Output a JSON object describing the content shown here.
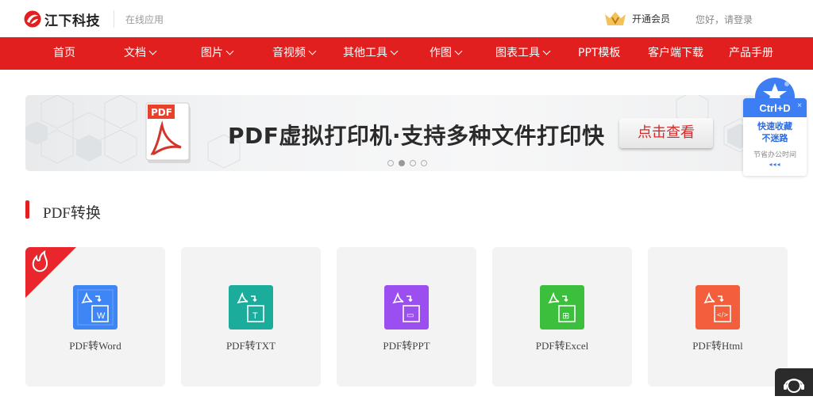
{
  "header": {
    "logo_text": "江下科技",
    "subtitle": "在线应用",
    "vip_label": "开通会员",
    "login_label": "您好，请登录"
  },
  "nav": {
    "items": [
      {
        "label": "首页",
        "has_dropdown": false
      },
      {
        "label": "文档",
        "has_dropdown": true
      },
      {
        "label": "图片",
        "has_dropdown": true
      },
      {
        "label": "音视频",
        "has_dropdown": true
      },
      {
        "label": "其他工具",
        "has_dropdown": true
      },
      {
        "label": "作图",
        "has_dropdown": true
      },
      {
        "label": "图表工具",
        "has_dropdown": true
      },
      {
        "label": "PPT模板",
        "has_dropdown": false
      },
      {
        "label": "客户端下载",
        "has_dropdown": false
      },
      {
        "label": "产品手册",
        "has_dropdown": false
      }
    ]
  },
  "banner": {
    "icon_text": "PDF",
    "title": "PDF虚拟打印机·支持多种文件打印快",
    "button_label": "点击查看",
    "active_slide": 2,
    "slide_count": 4
  },
  "side_widget": {
    "hotkey": "Ctrl+D",
    "line1": "快速收藏",
    "line2": "不迷路",
    "line3": "节省办公时间",
    "arrows": "◂◂◂",
    "close": "×"
  },
  "section": {
    "title": "PDF转换"
  },
  "cards": [
    {
      "label": "PDF转Word",
      "badge": "W",
      "color": "#3e86f5",
      "hot": true
    },
    {
      "label": "PDF转TXT",
      "badge": "T",
      "color": "#1bac9c",
      "hot": false
    },
    {
      "label": "PDF转PPT",
      "badge": "▭",
      "color": "#9b4ff0",
      "hot": false
    },
    {
      "label": "PDF转Excel",
      "badge": "⊞",
      "color": "#3cbf3c",
      "hot": false
    },
    {
      "label": "PDF转Html",
      "badge": "</>",
      "color": "#f35f3c",
      "hot": false
    }
  ],
  "colors": {
    "brand_red": "#e21f1f",
    "side_blue": "#3d7ef5"
  }
}
